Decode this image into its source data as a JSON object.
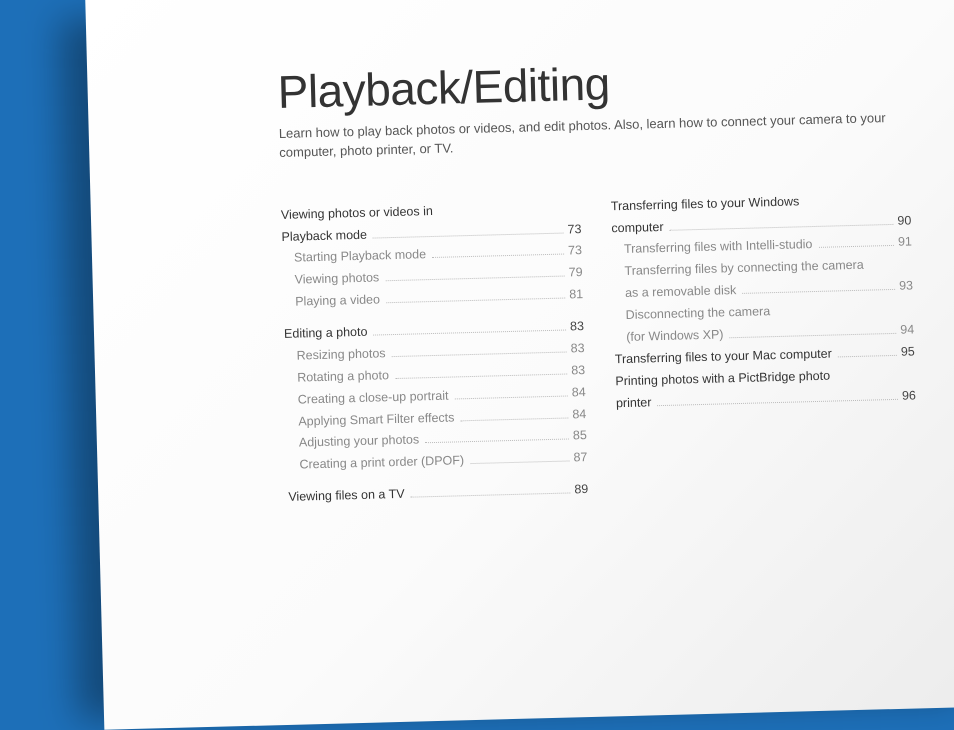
{
  "title": "Playback/Editing",
  "intro": "Learn how to play back photos or videos, and edit photos. Also, learn how to connect your camera to your computer, photo printer, or TV.",
  "col1": [
    {
      "type": "heading-only",
      "label": "Viewing photos or videos in"
    },
    {
      "type": "main",
      "label": "Playback mode",
      "page": "73"
    },
    {
      "type": "sub",
      "label": "Starting Playback mode",
      "page": "73"
    },
    {
      "type": "sub",
      "label": "Viewing photos",
      "page": "79"
    },
    {
      "type": "sub",
      "label": "Playing a video",
      "page": "81"
    },
    {
      "type": "gap"
    },
    {
      "type": "main",
      "label": "Editing a photo",
      "page": "83"
    },
    {
      "type": "sub",
      "label": "Resizing photos",
      "page": "83"
    },
    {
      "type": "sub",
      "label": "Rotating a photo",
      "page": "83"
    },
    {
      "type": "sub",
      "label": "Creating a close-up portrait",
      "page": "84"
    },
    {
      "type": "sub",
      "label": "Applying Smart Filter effects",
      "page": "84"
    },
    {
      "type": "sub",
      "label": "Adjusting your photos",
      "page": "85"
    },
    {
      "type": "sub",
      "label": "Creating a print order (DPOF)",
      "page": "87"
    },
    {
      "type": "gap"
    },
    {
      "type": "main",
      "label": "Viewing files on a TV",
      "page": "89"
    }
  ],
  "col2": [
    {
      "type": "heading-only",
      "label": "Transferring files to your Windows"
    },
    {
      "type": "main",
      "label": "computer",
      "page": "90"
    },
    {
      "type": "sub",
      "label": "Transferring files with Intelli-studio",
      "page": "91"
    },
    {
      "type": "sub-heading-only",
      "label": "Transferring files by connecting the camera"
    },
    {
      "type": "sub",
      "label": "as a removable disk",
      "page": "93"
    },
    {
      "type": "sub-heading-only",
      "label": "Disconnecting the camera"
    },
    {
      "type": "sub",
      "label": "(for Windows XP)",
      "page": "94"
    },
    {
      "type": "main",
      "label": "Transferring files to your Mac computer",
      "page": "95"
    },
    {
      "type": "heading-only",
      "label": "Printing photos with a PictBridge photo"
    },
    {
      "type": "main",
      "label": "printer",
      "page": "96"
    }
  ]
}
